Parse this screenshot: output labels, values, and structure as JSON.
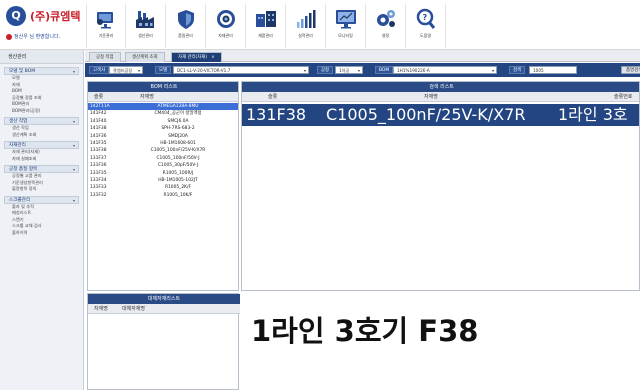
{
  "app": {
    "logo_mark": "Q",
    "logo_name": "(주)큐엠텍",
    "welcome": "정산우 님 환영합니다."
  },
  "menu": [
    {
      "label": "기준관리",
      "icon": "user-desk-icon"
    },
    {
      "label": "생산관리",
      "icon": "factory-icon"
    },
    {
      "label": "품질관리",
      "icon": "shield-icon"
    },
    {
      "label": "자재관리",
      "icon": "gauge-icon"
    },
    {
      "label": "재품관리",
      "icon": "warehouse-icon"
    },
    {
      "label": "실적관리",
      "icon": "bar-chart-icon"
    },
    {
      "label": "모니터링",
      "icon": "monitor-icon"
    },
    {
      "label": "설정",
      "icon": "gear-icon"
    },
    {
      "label": "도움말",
      "icon": "help-icon"
    }
  ],
  "sidebar": {
    "title": "생산관리",
    "groups": [
      {
        "title": "모델 및 BOM",
        "items": [
          "모델",
          "자재",
          "BOM",
          "공정별 정품 조회",
          "BOM관리",
          "BOM관리(공정)"
        ]
      },
      {
        "title": "생산 작업",
        "items": [
          "생산 작업",
          "생산계획 조회"
        ]
      },
      {
        "title": "자재관리",
        "items": [
          "자재 관리(자재)",
          "자재 실패조회"
        ]
      },
      {
        "title": "공정 품질 항목",
        "items": [
          "공정별 고품 관리",
          "기준생성항목관리",
          "불량항목 정의"
        ]
      },
      {
        "title": "스크롤관리",
        "items": [
          "출자 및 추적",
          "매칭리스트",
          "스캔기",
          "스크롤 교체 검사",
          "출하이력"
        ]
      }
    ]
  },
  "tabs": [
    {
      "label": "공정 작업"
    },
    {
      "label": "생산계획 조회"
    },
    {
      "label": "자재 관리(자재)"
    }
  ],
  "filter": {
    "line_label": "고객사",
    "line_value": "큐엠티공장",
    "model_label": "모델",
    "model_value": "DC1-LL-V-20-VICTOR-V1.7",
    "process_label": "공정",
    "process_value": "1차공",
    "bom_label": "BOM",
    "bom_value": "1H1%190226-A",
    "search_label": "검색",
    "search_value": "1005",
    "search_button": "품명검색"
  },
  "bom_list": {
    "title": "BOM 리스트",
    "col_loc": "슬롯",
    "col_name": "자재명",
    "rows": [
      {
        "loc": "142T11A",
        "name": "ATMEGA128A-8MU"
      },
      {
        "loc": "141F42",
        "name": "CM404_공군이 정밀액정"
      },
      {
        "loc": "141F40",
        "name": "SMCJ6.0A"
      },
      {
        "loc": "141F38",
        "name": "SPH-7RS-683-2"
      },
      {
        "loc": "141F36",
        "name": "SMDJ20A"
      },
      {
        "loc": "141F35",
        "name": "HB-1M1608-601"
      },
      {
        "loc": "131F38",
        "name": "C1005_100nF/25V-K/X7R"
      },
      {
        "loc": "131F37",
        "name": "C1005_100nF/50V-J"
      },
      {
        "loc": "131F36",
        "name": "C1005_30pF/50V-J"
      },
      {
        "loc": "131F35",
        "name": "R1005_100R/J"
      },
      {
        "loc": "131F34",
        "name": "HB-1M1005-102JT"
      },
      {
        "loc": "131F33",
        "name": "R1005_2K/F"
      },
      {
        "loc": "131F32",
        "name": "R1005_10K/F"
      }
    ],
    "selected_index": 0
  },
  "substitute_list": {
    "title": "대체자재리스트",
    "col_a": "자재명",
    "col_b": "대체자재명"
  },
  "search_result": {
    "title": "검색 리스트",
    "col_loc": "슬롯",
    "col_name": "자재명",
    "col_pos": "슬롯번호",
    "row": {
      "loc": "131F38",
      "name": "C1005_100nF/25V-K/X7R",
      "pos": "1라인 3호"
    }
  },
  "location_display": "1라인 3호기 F38",
  "colors": {
    "navy": "#234581",
    "panel_head": "#2b4b86",
    "selected_row": "#3b6fd6",
    "brand_red": "#c8202a"
  }
}
